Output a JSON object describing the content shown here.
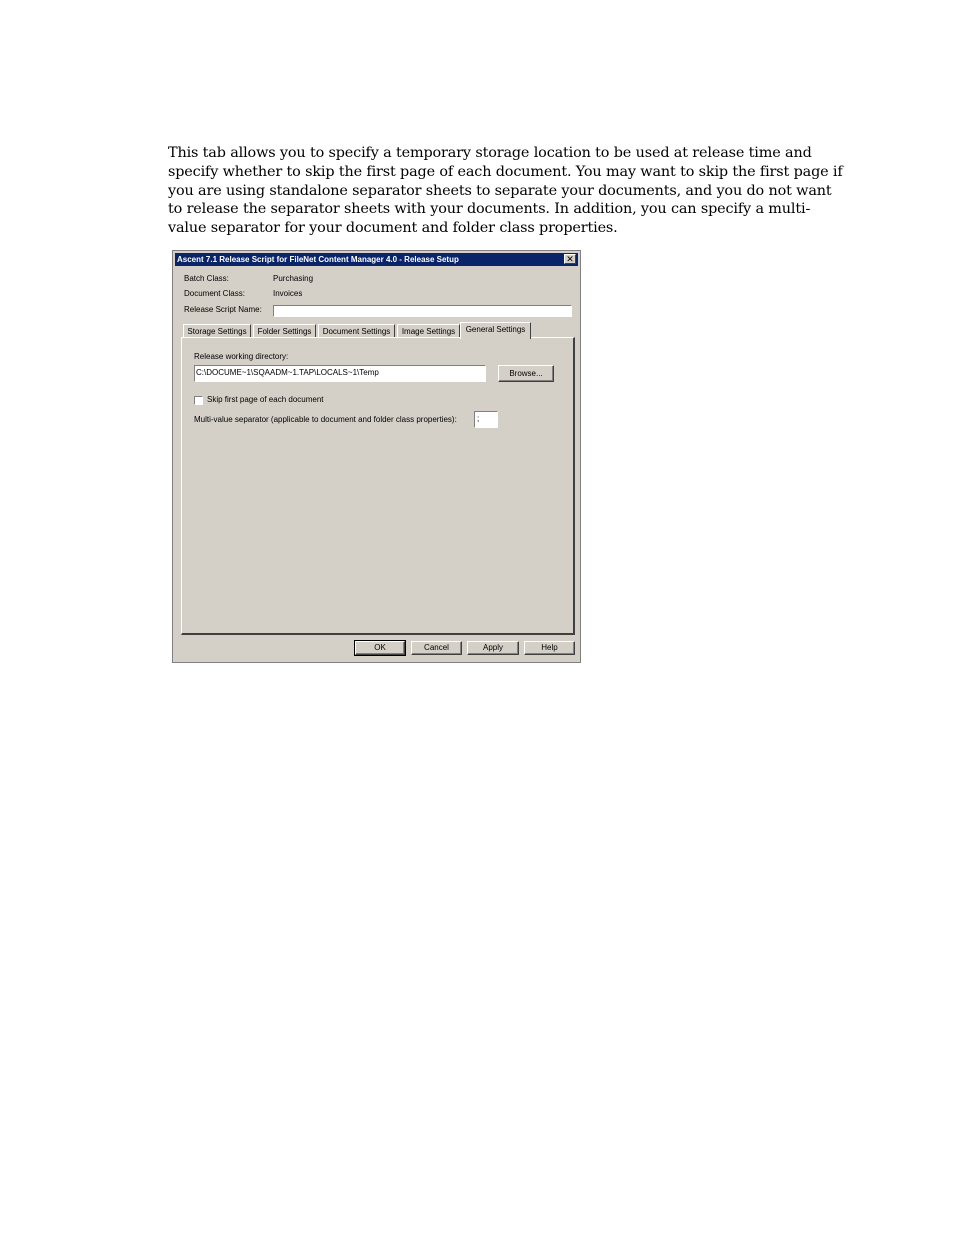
{
  "intro_text": "This tab allows you to specify a temporary storage location to be used at release time and specify whether to skip the first page of each document. You may want to skip the first page if you are using standalone separator sheets to separate your documents, and you do not want to release the separator sheets with your documents. In addition, you can specify a multi-value separator for your document and folder class properties.",
  "dialog": {
    "title": "Ascent 7.1 Release Script for FileNet Content Manager 4.0 - Release Setup",
    "close_glyph": "✕",
    "batch_class_label": "Batch Class:",
    "batch_class_value": "Purchasing",
    "document_class_label": "Document Class:",
    "document_class_value": "Invoices",
    "release_script_name_label": "Release Script Name:",
    "release_script_name_value": "",
    "tabs": [
      "Storage Settings",
      "Folder Settings",
      "Document Settings",
      "Image Settings",
      "General Settings"
    ],
    "active_tab": "General Settings",
    "general": {
      "working_dir_label": "Release working directory:",
      "working_dir_value": "C:\\DOCUME~1\\SQAADM~1.TAP\\LOCALS~1\\Temp",
      "browse_label": "Browse...",
      "skip_first_page_label": "Skip first page of each document",
      "skip_first_page_checked": false,
      "separator_label": "Multi-value separator (applicable to document and folder class properties):",
      "separator_value": ";"
    },
    "buttons": {
      "ok": "OK",
      "cancel": "Cancel",
      "apply": "Apply",
      "help": "Help"
    }
  }
}
